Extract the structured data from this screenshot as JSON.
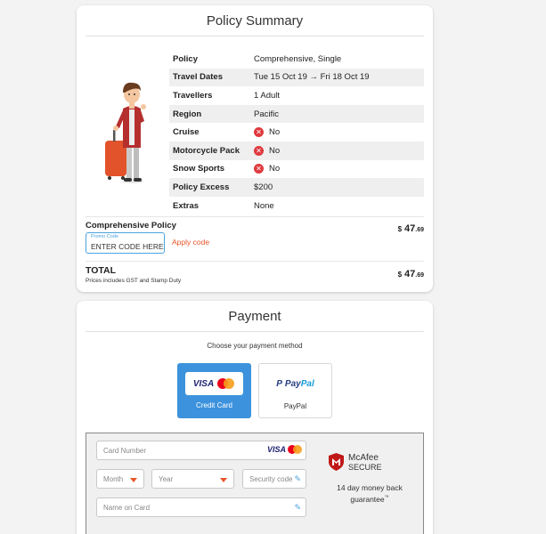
{
  "summary": {
    "title": "Policy Summary",
    "rows": [
      {
        "label": "Policy",
        "value": "Comprehensive, Single"
      },
      {
        "label": "Travel Dates",
        "value": "Tue 15 Oct 19 → Fri 18 Oct 19"
      },
      {
        "label": "Travellers",
        "value": "1 Adult"
      },
      {
        "label": "Region",
        "value": "Pacific"
      },
      {
        "label": "Cruise",
        "value": "No"
      },
      {
        "label": "Motorcycle Pack",
        "value": "No"
      },
      {
        "label": "Snow Sports",
        "value": "No"
      },
      {
        "label": "Policy Excess",
        "value": "$200"
      },
      {
        "label": "Extras",
        "value": "None"
      }
    ],
    "no_icon": "x-circle-icon",
    "comp_label": "Comprehensive Policy",
    "comp_price": {
      "currency": "$",
      "dollars": "47",
      "cents": ".69"
    },
    "promo": {
      "label": "Promo Code",
      "value": "ENTER CODE HERE"
    },
    "apply_label": "Apply code",
    "total_label": "TOTAL",
    "total_price": {
      "currency": "$",
      "dollars": "47",
      "cents": ".69"
    },
    "total_note": "Prices includes GST and Stamp Duty"
  },
  "payment": {
    "title": "Payment",
    "choose": "Choose your payment method",
    "options": {
      "credit_card": {
        "label": "Credit Card",
        "brand": "VISA",
        "selected": true
      },
      "paypal": {
        "label": "PayPal",
        "brand_a": "Pay",
        "brand_b": "Pal",
        "mark": "P"
      }
    },
    "card_number_placeholder": "Card Number",
    "month_placeholder": "Month",
    "year_placeholder": "Year",
    "security_placeholder": "Security code",
    "name_placeholder": "Name on Card",
    "card_brand": "VISA",
    "mcafee": {
      "name": "McAfee",
      "secure": "SECURE",
      "guarantee": "14 day money back guarantee",
      "tm": "™"
    }
  },
  "colors": {
    "accent": "#3c92dc",
    "orange": "#e8552a",
    "error": "#e0393e"
  }
}
